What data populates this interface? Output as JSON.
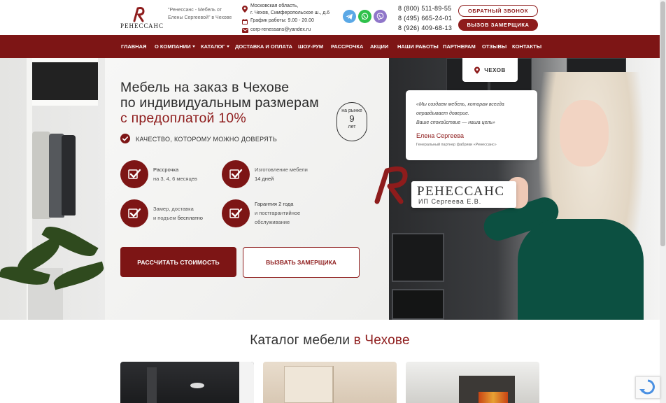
{
  "header": {
    "logo_text": "РЕНЕССАНС",
    "tagline": "\"Ренессанс - Мебель от Елены Сергеевой\" в Чехове",
    "address_line1": "Московская область,",
    "address_line2": "г. Чехов, Симферопольское ш., д.6",
    "hours": "График работы: 9.00 - 20.00",
    "email": "corp-renessans@yandex.ru",
    "phones": [
      "8 (800) 511-89-55",
      "8 (495) 665-24-01",
      "8 (926) 409-68-13"
    ],
    "callback_button": "ОБРАТНЫЙ ЗВОНОК",
    "measurer_button": "ВЫЗОВ ЗАМЕРЩИКА",
    "messengers": [
      "telegram-icon",
      "whatsapp-icon",
      "viber-icon"
    ]
  },
  "nav": {
    "items": [
      {
        "label": "ГЛАВНАЯ"
      },
      {
        "label": "О КОМПАНИИ"
      },
      {
        "label": "КАТАЛОГ"
      },
      {
        "label": "ДОСТАВКА И ОПЛАТА"
      },
      {
        "label": "ШОУ-РУМ"
      },
      {
        "label": "РАССРОЧКА"
      },
      {
        "label": "АКЦИИ"
      },
      {
        "label": "НАШИ РАБОТЫ"
      },
      {
        "label": "ПАРТНЕРАМ"
      },
      {
        "label": "ОТЗЫВЫ"
      },
      {
        "label": "КОНТАКТЫ"
      }
    ]
  },
  "hero": {
    "title_line1": "Мебель на заказ в Чехове",
    "title_line2": "по индивидуальным размерам",
    "title_line3": "с предоплатой 10%",
    "years_top": "на рынке",
    "years_num": "9",
    "years_bottom": "лет",
    "quality": "КАЧЕСТВО, КОТОРОМУ МОЖНО ДОВЕРЯТЬ",
    "features": [
      {
        "line1": "Рассрочка",
        "line2": "на 3, 4, 6 месяцев"
      },
      {
        "line1": "Изготовление мебели",
        "line2": "14 дней"
      },
      {
        "line1": "Замер, доставка",
        "line2a": "и подъем ",
        "line2b": "бесплатно"
      },
      {
        "line1": "Гарантия 2 года",
        "line2": "и постгарантийное",
        "line3": "обслуживание"
      }
    ],
    "calc_button": "РАССЧИТАТЬ СТОИМОСТЬ",
    "measure_button": "ВЫЗВАТЬ ЗАМЕРЩИКА",
    "city": "ЧЕХОВ",
    "quote_line1": "«Мы создаем мебель, которая всегда",
    "quote_line2": "оправдывает доверие.",
    "quote_line3": "Ваше спокойствие — наша цель»",
    "quote_name": "Елена Сергеева",
    "quote_role": "Генеральный партнер фабрики «Ренессанс»",
    "sign_brand": "РЕНЕССАНС",
    "sign_sub": "ИП Сергеева Е.В."
  },
  "catalog": {
    "title_a": "Каталог мебели ",
    "title_b": "в Чехове"
  },
  "colors": {
    "brand": "#7d1515",
    "accent": "#8e1c1c"
  }
}
